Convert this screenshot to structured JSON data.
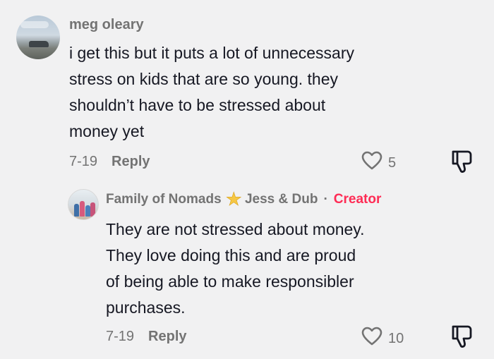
{
  "comments": [
    {
      "username": "meg oleary",
      "text": "i get this but it puts a lot of unnecessary\nstress on kids that are so young. they\nshouldn’t have to be stressed about\nmoney yet",
      "date": "7-19",
      "reply_label": "Reply",
      "like_count": "5",
      "icons": {
        "like": "heart-outline-icon",
        "dislike": "thumbs-down-icon"
      }
    }
  ],
  "reply": {
    "username": "Family of Nomads",
    "username_suffix": "Jess & Dub",
    "badge_icon": "star-icon",
    "separator": "·",
    "creator_label": "Creator",
    "text": "They are not stressed about money.\nThey love doing this and are proud\nof being able to make responsibler\npurchases.",
    "date": "7-19",
    "reply_label": "Reply",
    "like_count": "10",
    "icons": {
      "like": "heart-outline-icon",
      "dislike": "thumbs-down-icon"
    }
  },
  "colors": {
    "background": "#f1f1f2",
    "text": "#161823",
    "muted": "#737373",
    "creator": "#fe2c55",
    "star": "#f6c744"
  }
}
